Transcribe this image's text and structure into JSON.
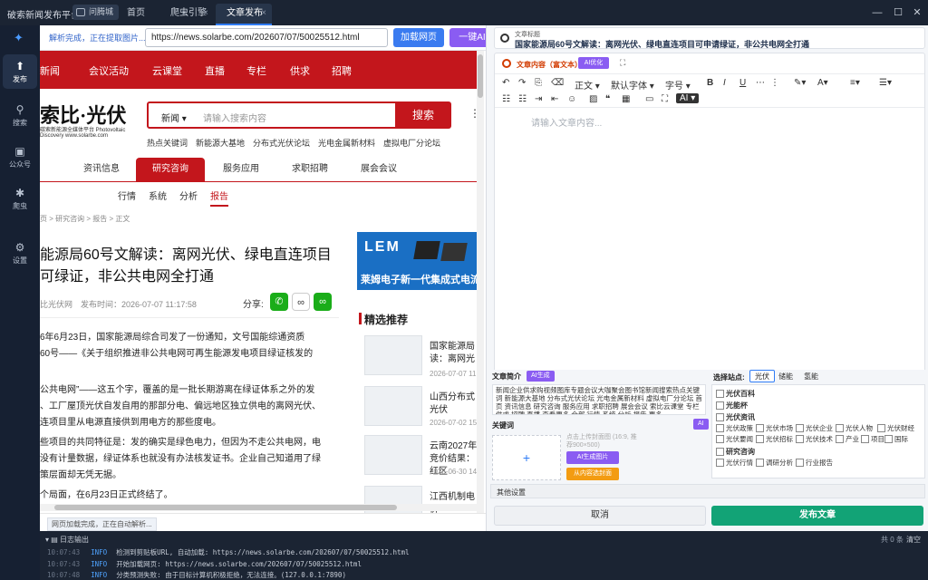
{
  "titlebar": {
    "app_title": "破索新闻发布平台",
    "badge": "问腾城",
    "tabs": [
      {
        "label": "首页"
      },
      {
        "label": "爬虫引擎"
      },
      {
        "label": "文章发布"
      }
    ],
    "min": "—",
    "max": "☐",
    "close": "✕"
  },
  "sidebar": {
    "items": [
      {
        "label": "发布",
        "icon": "publish-icon"
      },
      {
        "label": "搜索",
        "icon": "search-icon"
      },
      {
        "label": "公众号",
        "icon": "wechat-account-icon"
      },
      {
        "label": "爬虫",
        "icon": "spider-icon"
      },
      {
        "label": "设置",
        "icon": "gear-icon"
      }
    ]
  },
  "urlbar": {
    "status": "解析完成，正在提取图片...",
    "url": "https://news.solarbe.com/202607/07/50025512.html",
    "load_label": "加载网页",
    "ai_label": "一键AI"
  },
  "web": {
    "nav": [
      "新闻",
      "会议活动",
      "云课堂",
      "直播",
      "专栏",
      "供求",
      "招聘"
    ],
    "logo": "索比·光伏",
    "logo_sub": "碳索新能源全媒体平台 Photovoltaic Discovery www.solarbe.com",
    "search_cat": "新闻",
    "search_placeholder": "请输入搜索内容",
    "search_btn": "搜索",
    "hot_keywords": "热点关键词　新能源大基地　分布式光伏论坛　光电金属新材料　虚拟电厂分论坛",
    "cat_tabs": [
      "资讯信息",
      "研究咨询",
      "服务应用",
      "求职招聘",
      "展会会议"
    ],
    "sub_tabs": [
      "行情",
      "系统",
      "分析",
      "报告"
    ],
    "crumb": "页 > 研究咨询 > 报告 > 正文",
    "article_title": "能源局60号文解读：离网光伏、绿电直连项目可绿证，非公共电网全打通",
    "meta": "比光伏网　发布时间：2026-07-07 11:17:58",
    "share": "分享:",
    "paras": [
      "6年6月23日，国家能源局综合司发了一份通知，文号国能综通资质",
      "60号——《关于组织推进非公共电网可再生能源发电项目绿证核发的",
      "公共电网”——这五个字，覆盖的是一批长期游离在绿证体系之外的发",
      "、工厂屋顶光伏自发自用的那部分电、偏远地区独立供电的离网光伏、",
      "连项目里从电源直接供到用电方的那些度电。",
      "些项目的共同特征是：发的确实是绿色电力，但因为不走公共电网，电",
      "没有计量数据，绿证体系也就没有办法核发证书。企业自己知道用了绿",
      "策层面却无凭无据。",
      "个局面，在6月23日正式终结了。"
    ],
    "ad_brand": "LEM",
    "ad_text": "莱姆电子新一代集成式电流",
    "pick_title": "精选推荐",
    "picks": [
      {
        "title": "国家能源局读：离网光",
        "date": "2026-07-07 11"
      },
      {
        "title": "山西分布式光伏",
        "date": "2026-07-02 15"
      },
      {
        "title": "云南2027年竞价结果：红区",
        "date": "2026-06-30 14"
      },
      {
        "title": "江西机制电价",
        "date": ""
      }
    ]
  },
  "web_status": "网页加载完成，正在自动解析...",
  "editor": {
    "title_label": "文章标题",
    "title_value": "国家能源局60号文解读：离网光伏、绿电直连项目可申请绿证，非公共电网全打通",
    "content_label": "文章内容（富文本）",
    "ai_optimize": "AI优化",
    "font_style": "正文",
    "font_family": "默认字体",
    "font_size": "字号",
    "ai_tool": "AI",
    "placeholder": "请输入文章内容...",
    "summary_label": "文章简介",
    "summary_ai": "AI生成",
    "summary_text": "新闻企业供求购视频图库专题会议大咖聚会图书馆新闻搜索热点关键词 新能源大基地 分布式光伏论坛 光电金属新材料 虚拟电厂分论坛 首页 资讯信息 研究咨询 服务应用 求职招聘 展会会议 索比云课堂 专栏 供求 招聘 直播 查看更多 全部 行情 系统 分析 报告 更多",
    "keywords_label": "关键词",
    "keywords_ai": "AI",
    "cover_hint": "点击上传封面图 (16:9, 推荐900×500)",
    "gen_cover": "AI生成图片",
    "extract_cover": "从内容选封面",
    "sites_label": "选择站点:",
    "sites": [
      "光伏",
      "储能",
      "氢能"
    ],
    "categories": {
      "c1": "光伏百科",
      "c2": "光能杯",
      "c3": "光伏资讯",
      "c3_items": [
        "光伏政策",
        "光伏市场",
        "光伏企业",
        "光伏人物",
        "光伏财经",
        "光伏要闻",
        "光伏招标",
        "光伏技术",
        "产业",
        "项目",
        "国际"
      ],
      "c4": "研究咨询",
      "c4_items": [
        "光伏行情",
        "调研分析",
        "行业报告"
      ]
    },
    "other": "其他设置",
    "cancel": "取消",
    "publish": "发布文章"
  },
  "log": {
    "title": "日志输出",
    "count": "共 0 条",
    "clear": "清空",
    "lines": [
      {
        "t": "10:07:43",
        "lv": "INFO",
        "msg": "检测到剪贴板URL, 自动加载: https://news.solarbe.com/202607/07/50025512.html"
      },
      {
        "t": "10:07:43",
        "lv": "INFO",
        "msg": "开始加载网页: https://news.solarbe.com/202607/07/50025512.html"
      },
      {
        "t": "10:07:48",
        "lv": "INFO",
        "msg": "分类预测失败: 由于目标计算机积极拒绝，无法连接。(127.0.0.1:7890)"
      }
    ]
  },
  "colors": {
    "brand_red": "#c3161c",
    "primary": "#3a7bf0",
    "ai_purple": "#8a5cf2",
    "publish_green": "#12a376",
    "dark_bg": "#1b2433"
  }
}
